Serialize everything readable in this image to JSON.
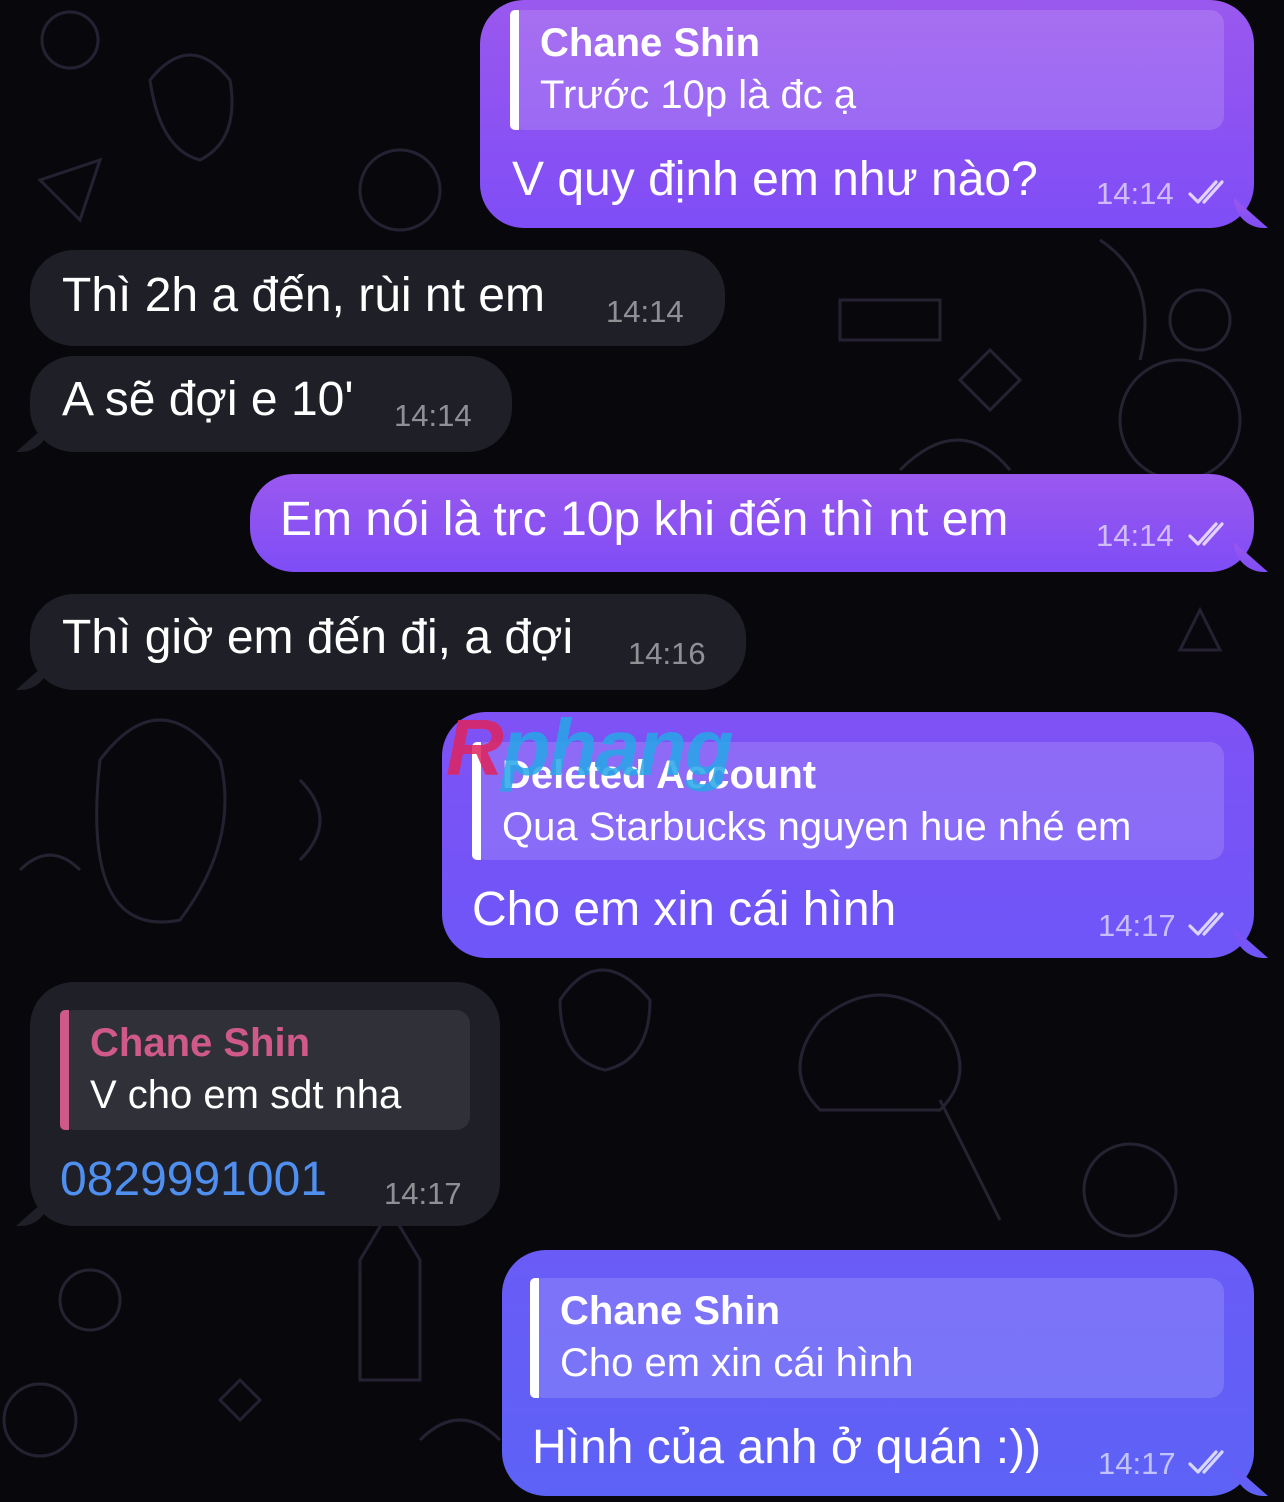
{
  "messages": [
    {
      "direction": "out",
      "reply": {
        "name": "Chane Shin",
        "text": "Trước 10p là đc ạ"
      },
      "text": "V quy định em như nào?",
      "time": "14:14",
      "status": "read"
    },
    {
      "direction": "in",
      "text": "Thì 2h a đến, rùi nt em",
      "time": "14:14"
    },
    {
      "direction": "in",
      "text": "A sẽ đợi e 10'",
      "time": "14:14"
    },
    {
      "direction": "out",
      "text": "Em nói là trc 10p khi đến thì nt em",
      "time": "14:14",
      "status": "read"
    },
    {
      "direction": "in",
      "text": "Thì giờ em đến đi, a đợi",
      "time": "14:16"
    },
    {
      "direction": "out",
      "reply": {
        "name": "Deleted Account",
        "text": "Qua Starbucks nguyen hue nhé em"
      },
      "text": "Cho em xin cái hình",
      "time": "14:17",
      "status": "read"
    },
    {
      "direction": "in",
      "reply": {
        "name": "Chane Shin",
        "text": "V cho em sdt nha"
      },
      "text": "0829991001",
      "time": "14:17"
    },
    {
      "direction": "out",
      "reply": {
        "name": "Chane Shin",
        "text": "Cho em xin cái hình"
      },
      "text": "Hình của anh ở quán :))",
      "time": "14:17",
      "status": "read"
    }
  ],
  "watermark": {
    "first": "R",
    "rest": "phang"
  },
  "icons": {
    "read_status": "double-check-icon"
  },
  "colors": {
    "background": "#08080c",
    "incoming_bubble": "#1f1f28",
    "outgoing_bubble_top": "#9a58ee",
    "outgoing_bubble_bottom": "#5d62f6",
    "reply_name_incoming": "#d0598c",
    "phone_link": "#4f8ff0"
  }
}
